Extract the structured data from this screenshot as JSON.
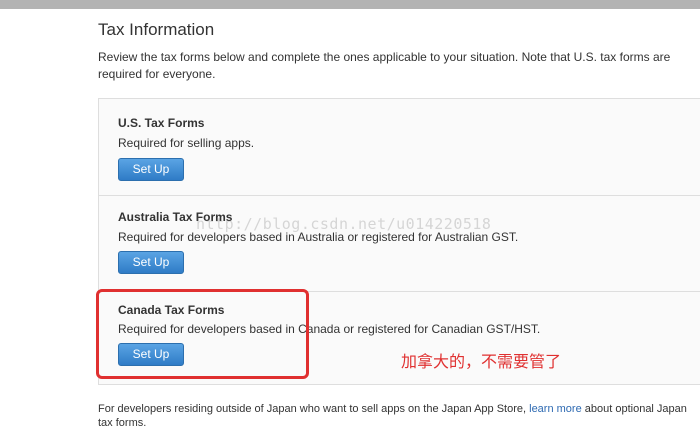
{
  "header": {
    "title": "Tax Information"
  },
  "intro": {
    "line1": "Review the tax forms below and complete the ones applicable to your situation. Note that U.S. tax forms are",
    "line2": "required for everyone."
  },
  "forms": [
    {
      "title": "U.S. Tax Forms",
      "description": "Required for selling apps.",
      "button_label": "Set Up"
    },
    {
      "title": "Australia Tax Forms",
      "description": "Required for developers based in Australia or registered for Australian GST.",
      "button_label": "Set Up"
    },
    {
      "title": "Canada Tax Forms",
      "description": "Required for developers based in Canada or registered for Canadian GST/HST.",
      "button_label": "Set Up"
    }
  ],
  "watermark": "http://blog.csdn.net/u014220518",
  "annotation": {
    "text": "加拿大的，不需要管了",
    "color": "#e03030"
  },
  "footer": {
    "line1_prefix": "For developers residing outside of Japan who want to sell apps on the Japan App Store,",
    "link_label": "learn more",
    "line1_suffix": "about optional Japan",
    "line2": "tax forms."
  },
  "colors": {
    "button": "#2f7bc6",
    "link": "#2e6ab2",
    "highlight": "#e03030"
  }
}
